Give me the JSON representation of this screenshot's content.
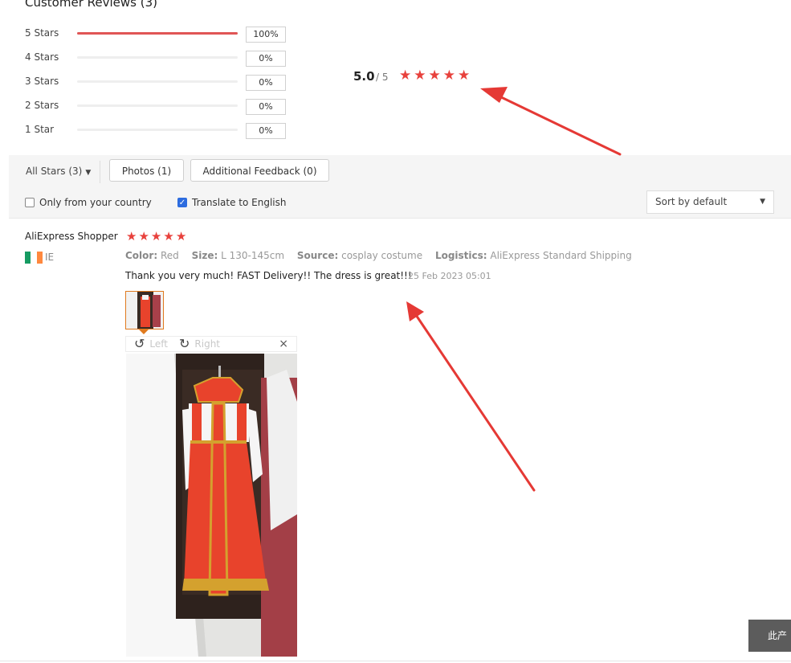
{
  "summary": {
    "title": "Customer Reviews (3)",
    "rows": [
      {
        "label": "5 Stars",
        "percent": "100%",
        "fill": 1.0
      },
      {
        "label": "4 Stars",
        "percent": "0%",
        "fill": 0
      },
      {
        "label": "3 Stars",
        "percent": "0%",
        "fill": 0
      },
      {
        "label": "2 Stars",
        "percent": "0%",
        "fill": 0
      },
      {
        "label": "1 Star",
        "percent": "0%",
        "fill": 0
      }
    ],
    "score": "5.0",
    "score_max": "/ 5",
    "stars": 5
  },
  "filters": {
    "all_stars": "All Stars (3)",
    "photos": "Photos (1)",
    "additional": "Additional Feedback (0)",
    "only_country": "Only from your country",
    "only_country_checked": false,
    "translate": "Translate to English",
    "translate_checked": true,
    "sort": "Sort by default"
  },
  "review": {
    "reviewer": "AliExpress Shopper",
    "stars": 5,
    "country": "IE",
    "color_label": "Color:",
    "color_value": "Red",
    "size_label": "Size:",
    "size_value": "L 130-145cm",
    "source_label": "Source:",
    "source_value": "cosplay costume",
    "logistics_label": "Logistics:",
    "logistics_value": "AliExpress Standard Shipping",
    "text": "Thank you very much! FAST Delivery!! The dress is great!!!",
    "date": "25 Feb 2023 05:01",
    "viewer": {
      "left_label": "Left",
      "right_label": "Right",
      "close": "×"
    }
  },
  "corner_button": "此产",
  "colors": {
    "star": "#e8413c",
    "bar_fill": "#e05555",
    "arrow": "#e53935",
    "thumb_border": "#e07a1e"
  }
}
